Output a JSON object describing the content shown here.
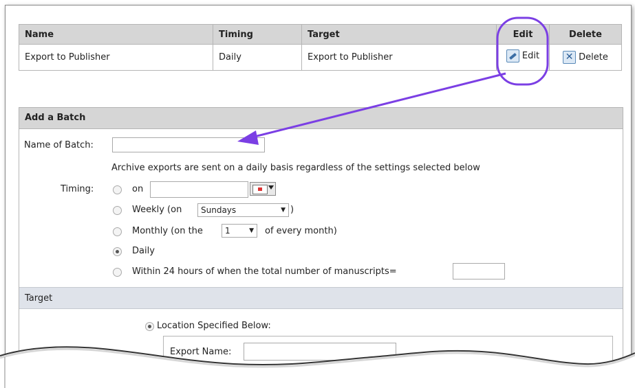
{
  "table": {
    "headers": {
      "name": "Name",
      "timing": "Timing",
      "target": "Target",
      "edit": "Edit",
      "delete": "Delete"
    },
    "rows": [
      {
        "name": "Export to Publisher",
        "timing": "Daily",
        "target": "Export to Publisher",
        "edit": "Edit",
        "delete": "Delete"
      }
    ]
  },
  "add_batch": {
    "title": "Add a Batch",
    "name_label": "Name of Batch:",
    "name_value": "",
    "archive_note": "Archive exports are sent on a daily basis regardless of the settings selected below",
    "timing_label": "Timing:",
    "options": {
      "on": "on",
      "weekly_prefix": "Weekly (on",
      "weekly_suffix": ")",
      "weekly_value": "Sundays",
      "monthly_prefix": "Monthly (on the",
      "monthly_value": "1",
      "monthly_suffix": "of every month)",
      "daily": "Daily",
      "within": "Within 24 hours of when the total number of manuscripts="
    },
    "selected": "daily"
  },
  "target": {
    "title": "Target",
    "location_label": "Location Specified Below:",
    "export_name_label": "Export Name:",
    "export_name_value": ""
  },
  "annotation": {
    "color": "#7b3fe4"
  },
  "icons": {
    "edit": "pencil-icon",
    "delete": "close-x-icon",
    "calendar": "calendar-icon"
  }
}
